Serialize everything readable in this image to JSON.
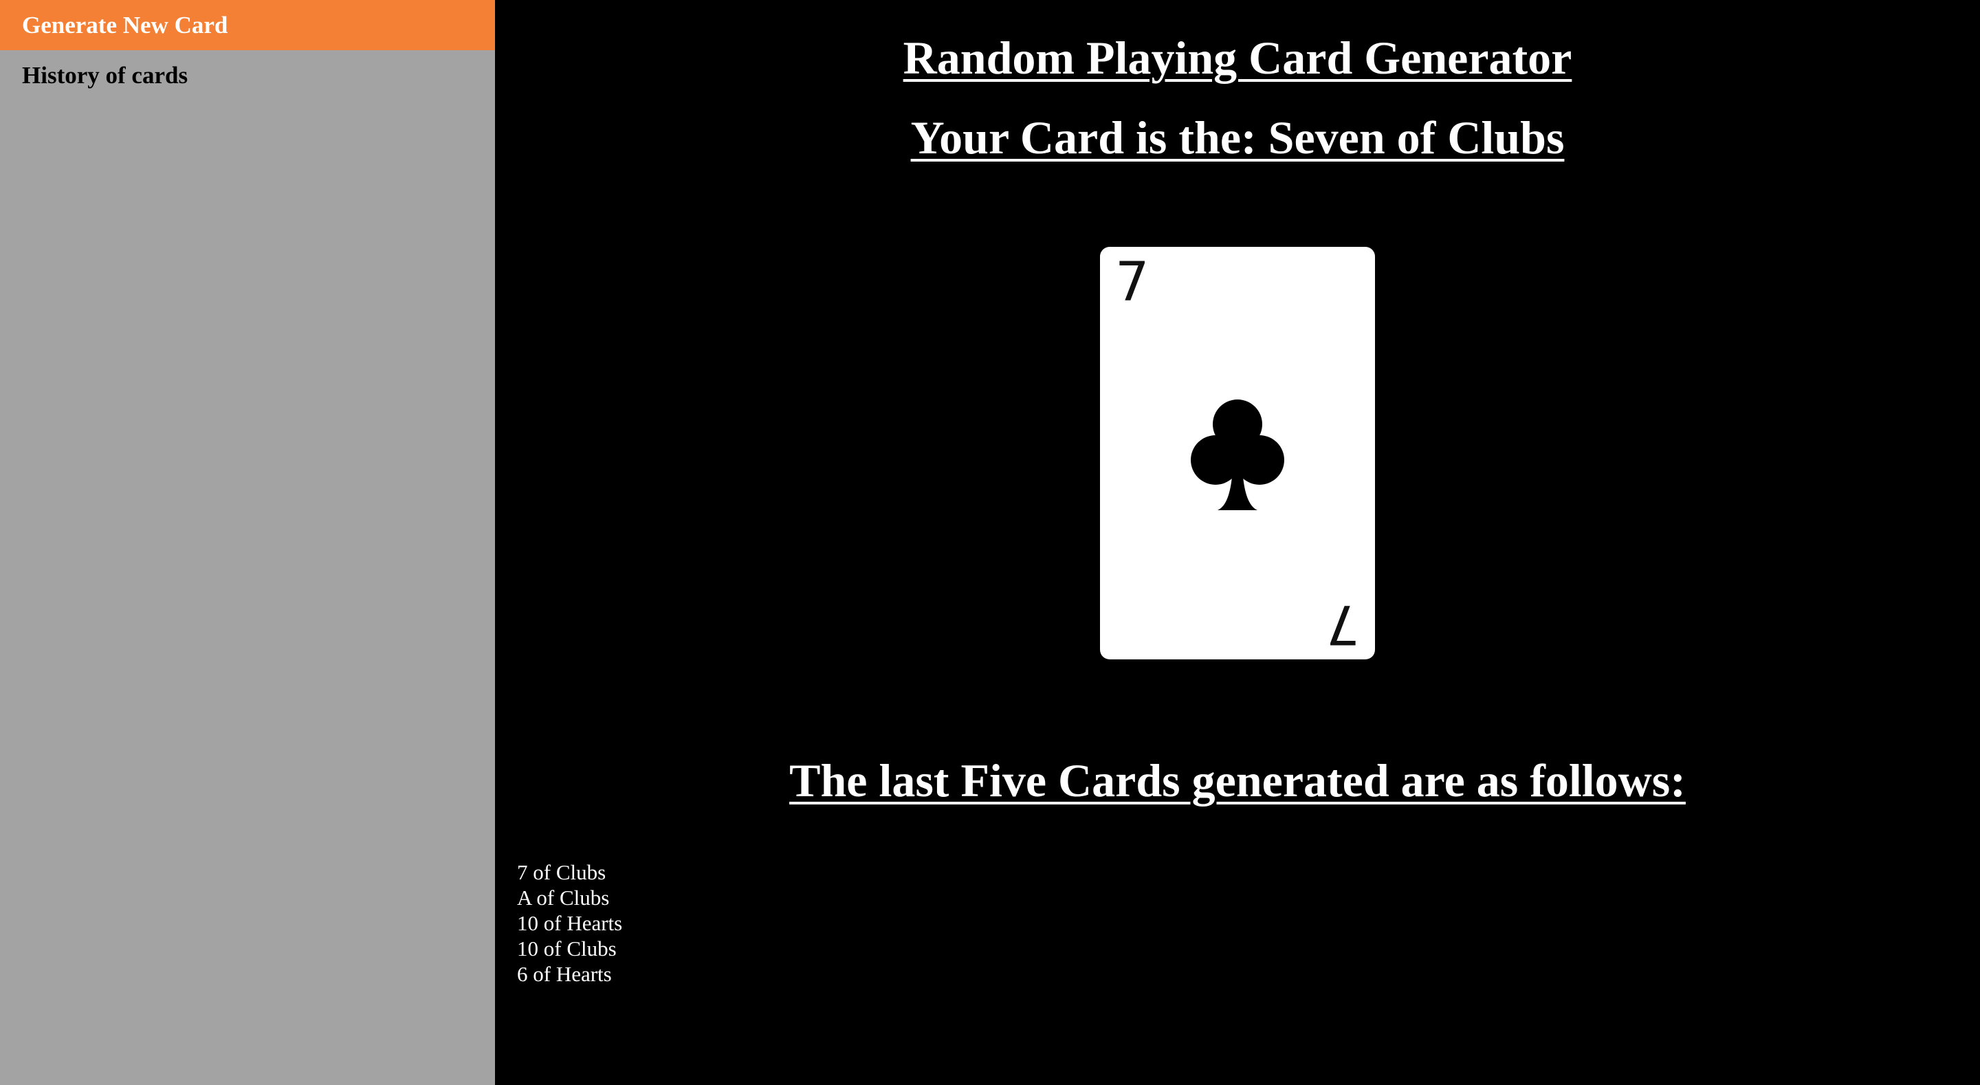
{
  "sidebar": {
    "items": [
      {
        "label": "Generate New Card",
        "active": true
      },
      {
        "label": "History of cards",
        "active": false
      }
    ]
  },
  "main": {
    "title": "Random Playing Card Generator",
    "current_card_text": "Your Card is the: Seven of Clubs",
    "card": {
      "rank": "7",
      "suit_symbol": "♣",
      "suit_icon": "club-icon",
      "color": "#000000"
    },
    "history_heading": "The last Five Cards generated are as follows:",
    "history": [
      "7 of Clubs",
      "A of Clubs",
      "10 of Hearts",
      "10 of Clubs",
      "6 of Hearts"
    ]
  },
  "colors": {
    "sidebar_bg": "#a3a3a3",
    "active_nav_bg": "#f48035",
    "main_bg": "#000000",
    "text": "#ffffff"
  }
}
